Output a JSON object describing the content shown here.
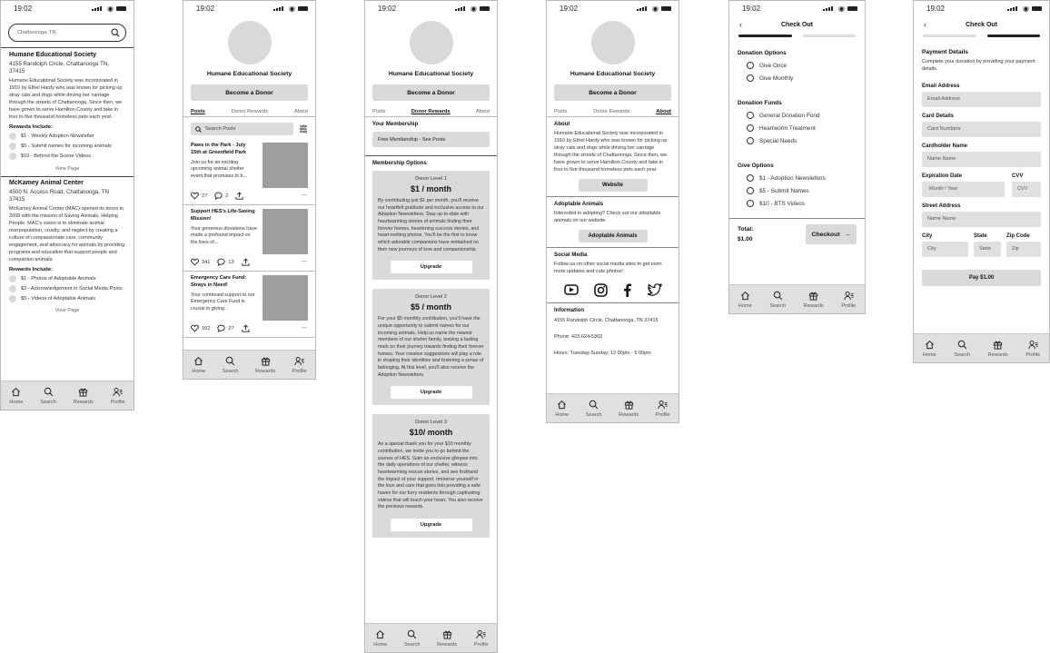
{
  "status_time": "19:02",
  "nav": [
    "Home",
    "Search",
    "Rewards",
    "Profile"
  ],
  "search": {
    "value": "Chattanooga, TN"
  },
  "results": [
    {
      "name": "Humane Educational Society",
      "address": "4155 Randolph Circle, Chattanooga TN, 37415",
      "desc": "Humane Educational Society was incorporated in 1910 by Ethel Hardy who was known for picking up stray cats and dogs while driving her carriage through the streets of Chattanooga. Since then, we have grown to serve Hamilton County and take in four to five thousand homeless pets each year.",
      "rewards_label": "Rewards Include:",
      "rewards": [
        "$1 - Weekly Adoption Newsletter",
        "$5 - Submit names for incoming animals",
        "$10 - Behind the Scene Videos"
      ],
      "view": "View Page"
    },
    {
      "name": "McKamey Animal Center",
      "address": "4500 N. Access Road, Chattanooga, TN 37415",
      "desc": "McKamey Animal Center (MAC) opened its doors in 2008 with the mission of Saving Animals, Helping People. MAC's vision is to eliminate animal overpopulation, cruelty, and neglect by creating a culture of compassionate care, community engagement, and advocacy for animals by providing programs and education that support people and companion animals.",
      "rewards_label": "Rewards Include:",
      "rewards": [
        "$1 - Photos of Adoptable Animals",
        "$3 - Acknowledgement in Social Media Posts",
        "$5 - Videos of Adoptable Animals"
      ],
      "view": "View Page"
    }
  ],
  "org": {
    "name": "Humane Educational Society",
    "donor_btn": "Become a Donor",
    "tabs": [
      "Posts",
      "Donor Rewards",
      "About"
    ]
  },
  "posts_screen": {
    "search_placeholder": "Search Posts",
    "posts": [
      {
        "title": "Paws in the Park - July 15th at Greenfield Park",
        "desc": "Join us for an exciting upcoming animal shelter event that promises to b...",
        "likes": "27",
        "comments": "2"
      },
      {
        "title": "Support HES's Life-Saving Mission!",
        "desc": "Your generous donations have made a profound impact on the lives of...",
        "likes": "341",
        "comments": "13"
      },
      {
        "title": "Emergency Care Fund: Strays in Need!",
        "desc": "Your continued support to our Emergency Care Fund is crucial in giving...",
        "likes": "102",
        "comments": "27"
      }
    ]
  },
  "rewards_screen": {
    "membership_title": "Your Membership",
    "membership_value": "Free Membership - See Posts",
    "options_title": "Membership Options",
    "levels": [
      {
        "level": "Donor Level 1",
        "price": "$1 / month",
        "desc": "By contributing just $1 per month, you'll receive our heartfelt gratitude and exclusive access to our Adoption Newsletters. Stay up-to-date with heartwarming stories of animals finding their forever homes, heartening success stories, and heart-melting photos. You'll be the first to know which adorable companions have embarked on their new journeys of love and companionship.",
        "btn": "Upgrade"
      },
      {
        "level": "Donor Level 2",
        "price": "$5 / month",
        "desc": "For your $5 monthly contribution, you'll have the unique opportunity to submit names for our incoming animals. Help us name the newest members of our shelter family, leaving a lasting mark on their journey towards finding their forever homes. Your creative suggestions will play a role in shaping their identities and fostering a sense of belonging. At this level, you'll also receive the Adoption Newsletters.",
        "btn": "Upgrade"
      },
      {
        "level": "Donor Level 3",
        "price": "$10/ month",
        "desc": "As a special thank you for your $10 monthly contribution, we invite you to go behind the scenes of HES. Gain an exclusive glimpse into the daily operations of our shelter, witness heartwarming rescue stories, and see firsthand the impact of your support. Immerse yourself in the love and care that goes into providing a safe haven for our furry residents through captivating videos that will touch your heart. You also receive the previous rewards.",
        "btn": "Upgrade"
      }
    ]
  },
  "about_screen": {
    "about_title": "About",
    "about_text": "Humane Educational Society was incorporated in 1910 by Ethel Hardy who was known for picking up stray cats and dogs while driving her carriage through the streets of Chattanooga. Since then, we have grown to serve Hamilton County and take in four to five thousand homeless pets each year.",
    "website_btn": "Website",
    "adopt_title": "Adoptable Animals",
    "adopt_text": "Interested in adopting? Check out our adoptable animals on our website.",
    "adopt_btn": "Adoptable Animals",
    "social_title": "Social Media",
    "social_text": "Follow us on other social media sites to get even more updates and cute photos!",
    "info_title": "Information",
    "address": "4155 Randolph Circle, Chattanooga, TN 37415",
    "phone": "Phone: 423-624-5302",
    "hours": "Hours: Tuesday-Sunday: 12:00pm - 5:00pm"
  },
  "checkout1": {
    "title": "Check Out",
    "options_title": "Donation Options",
    "options": [
      "Give Once",
      "Give Monthly"
    ],
    "funds_title": "Donation Funds",
    "funds": [
      "General Donation Fund",
      "Heartworm Treatment",
      "Special Needs"
    ],
    "give_title": "Give Options",
    "give": [
      "$1 - Adoption Newsletters",
      "$5 - Submit Names",
      "$10 - BTS Videos"
    ],
    "total_label": "Total:",
    "total_value": "$1.00",
    "checkout_btn": "Checkout"
  },
  "checkout2": {
    "title": "Check Out",
    "section_title": "Payment Details",
    "section_text": "Complete your donation by providing your payment details.",
    "email_label": "Email Address",
    "email_ph": "Email Address",
    "card_label": "Card Details",
    "card_ph": "Card Numbers",
    "holder_label": "Cardholder Name",
    "holder_ph": "Name Name",
    "exp_label": "Expiration Date",
    "exp_ph": "Month / Year",
    "cvv_label": "CVV",
    "cvv_ph": "CVV",
    "street_label": "Street Address",
    "street_ph": "Name Name",
    "city_label": "City",
    "city_ph": "City",
    "state_label": "State",
    "state_ph": "State",
    "zip_label": "Zip Code",
    "zip_ph": "Zip",
    "pay_btn": "Pay $1.00"
  }
}
